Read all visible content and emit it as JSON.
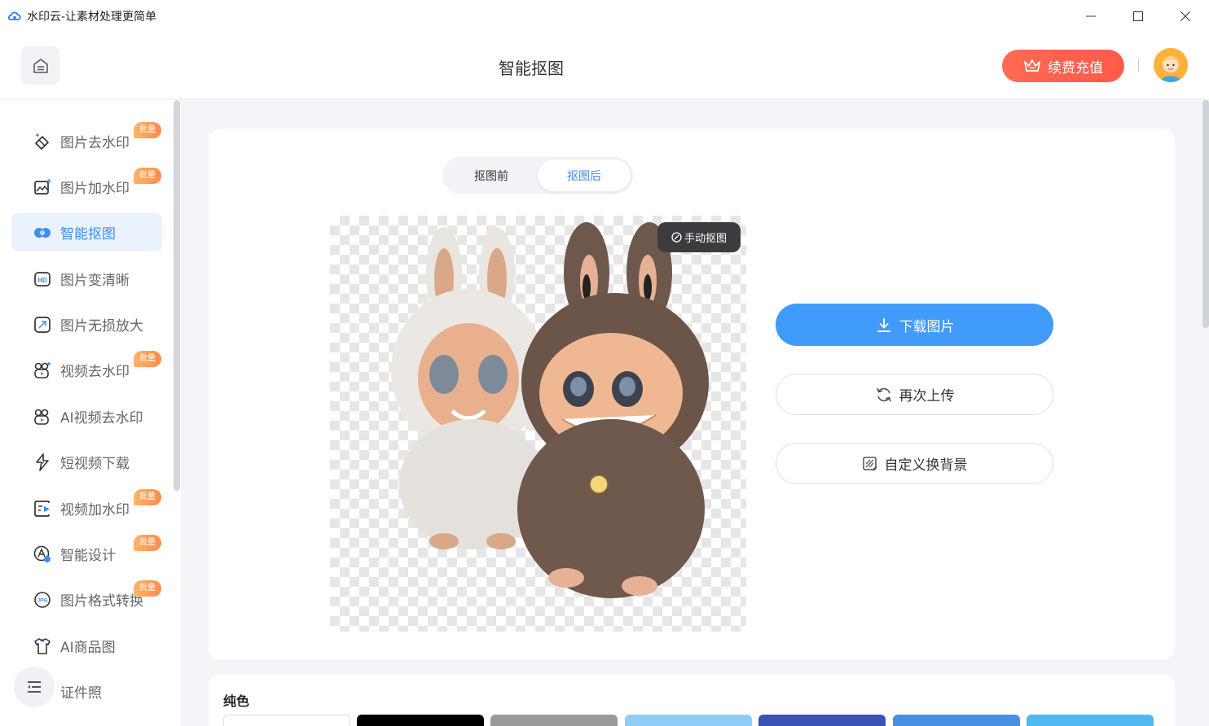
{
  "window": {
    "title": "水印云-让素材处理更简单",
    "controls": [
      "minimize",
      "maximize",
      "close"
    ]
  },
  "header": {
    "page_title": "智能抠图",
    "vip_label": "续费充值"
  },
  "sidebar": {
    "items": [
      {
        "label": "图片去水印",
        "badge": "批量",
        "icon": "eraser-icon"
      },
      {
        "label": "图片加水印",
        "badge": "批量",
        "icon": "image-add-icon"
      },
      {
        "label": "智能抠图",
        "badge": "",
        "icon": "cutout-icon",
        "active": true
      },
      {
        "label": "图片变清晰",
        "badge": "",
        "icon": "hd-icon"
      },
      {
        "label": "图片无损放大",
        "badge": "",
        "icon": "enlarge-icon"
      },
      {
        "label": "视频去水印",
        "badge": "批量",
        "icon": "video-eraser-icon"
      },
      {
        "label": "AI视频去水印",
        "badge": "",
        "icon": "ai-video-icon"
      },
      {
        "label": "短视频下载",
        "badge": "",
        "icon": "download-video-icon"
      },
      {
        "label": "视频加水印",
        "badge": "批量",
        "icon": "video-add-icon"
      },
      {
        "label": "智能设计",
        "badge": "批量",
        "icon": "design-icon"
      },
      {
        "label": "图片格式转换",
        "badge": "批量",
        "icon": "jpg-icon"
      },
      {
        "label": "AI商品图",
        "badge": "",
        "icon": "tshirt-icon"
      },
      {
        "label": "证件照",
        "badge": "",
        "icon": "id-photo-icon"
      }
    ]
  },
  "toggle": {
    "before": "抠图前",
    "after": "抠图后",
    "selected": "after"
  },
  "preview": {
    "manual_label": "手动抠图"
  },
  "actions": {
    "download": "下载图片",
    "reupload": "再次上传",
    "custom_bg": "自定义换背景"
  },
  "backgrounds": {
    "title": "纯色",
    "colors": [
      "#ffffff",
      "#000000",
      "#999999",
      "#8fcdf7",
      "#3a52b4",
      "#4a90e2",
      "#4fb8f0"
    ]
  },
  "colors": {
    "accent": "#409bfb",
    "vip": "#ff6350",
    "badge": "#ff9a55"
  }
}
